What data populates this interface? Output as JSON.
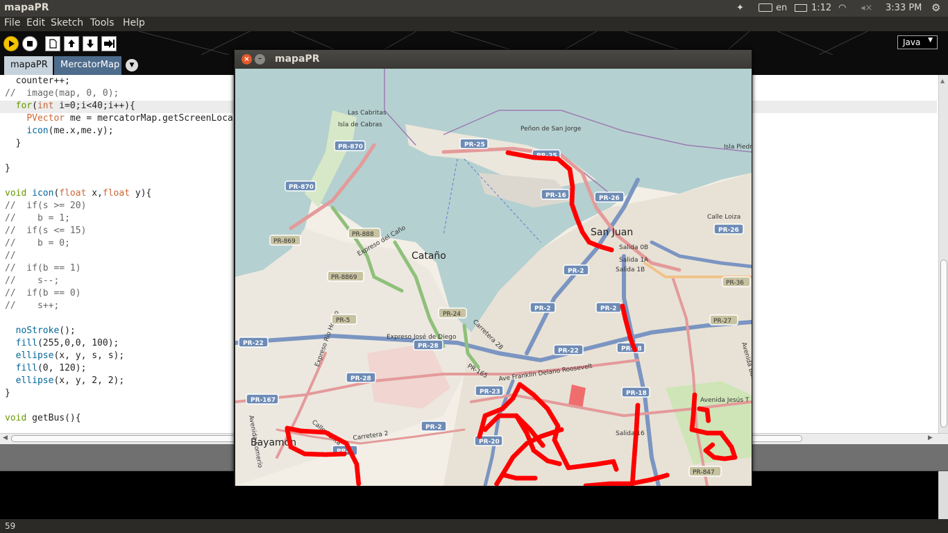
{
  "system": {
    "app_title": "mapaPR",
    "lang": "en",
    "battery": "1:12",
    "clock": "3:33 PM"
  },
  "menu": [
    "File",
    "Edit",
    "Sketch",
    "Tools",
    "Help"
  ],
  "toolbar": {
    "mode": "Java"
  },
  "tabs": [
    {
      "label": "mapaPR",
      "active": true
    },
    {
      "label": "MercatorMap",
      "active": false
    }
  ],
  "code": [
    "  counter++;",
    "//  image(map, 0, 0);",
    "  for(int i=0;i<40;i++){",
    "    PVector me = mercatorMap.getScreenLoca",
    "    icon(me.x,me.y);",
    "  }",
    "",
    "}",
    "",
    "void icon(float x,float y){",
    "//  if(s >= 20)",
    "//    b = 1;",
    "//  if(s <= 15)",
    "//    b = 0;",
    "//",
    "//  if(b == 1)",
    "//    s--;",
    "//  if(b == 0)",
    "//    s++;",
    "",
    "  noStroke();",
    "  fill(255,0,0, 100);",
    "  ellipse(x, y, s, s);",
    "  fill(0, 120);",
    "  ellipse(x, y, 2, 2);",
    "}",
    "",
    "void getBus(){"
  ],
  "status": {
    "line": "59"
  },
  "sketch_window": {
    "title": "mapaPR"
  },
  "map": {
    "places": [
      "Las Cabritas",
      "Isla de Cabras",
      "Peñon de San Jorge",
      "Isla Piedra",
      "San Juan",
      "Cataño",
      "Bayamón",
      "Salida 0B",
      "Salida 1A",
      "Salida 1B",
      "Salida 16",
      "Calle Loiza",
      "Expreso Río Hondo",
      "Expreso José de Diego",
      "Expreso del Caño",
      "Ave Franklin Delano Roosevelt",
      "Avenida Jesús T Piñero",
      "Carretera 2",
      "Carretera 28",
      "Avenida Barbosa",
      "Avenida Comerío",
      "Calle Santa"
    ],
    "routes": [
      "PR-870",
      "PR-25",
      "PR-16",
      "PR-26",
      "PR-888",
      "PR-869",
      "PR-8869",
      "PR-2",
      "PR-24",
      "PR-5",
      "PR-22",
      "PR-28",
      "PR-18",
      "PR-36",
      "PR-27",
      "PR-167",
      "PR-23",
      "PR-20",
      "PR-847",
      "PR-165"
    ]
  }
}
